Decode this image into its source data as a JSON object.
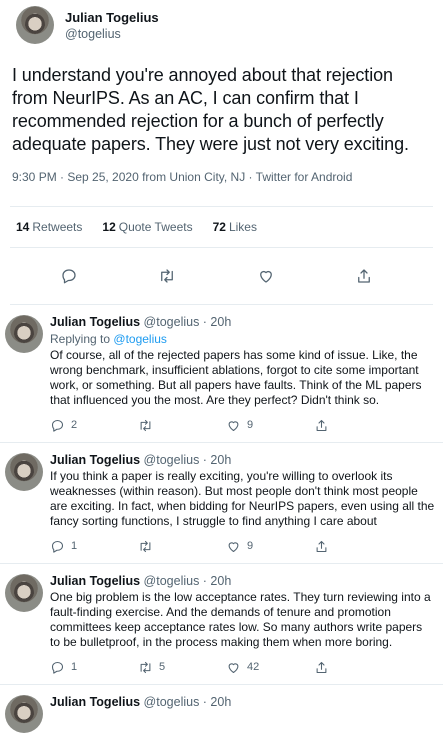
{
  "main_tweet": {
    "author_name": "Julian Togelius",
    "author_handle": "@togelius",
    "text": "I understand you're annoyed about that rejection from NeurIPS. As an AC, I can confirm that I recommended rejection for a bunch of perfectly adequate papers. They were just not very exciting.",
    "meta": "9:30 PM · Sep 25, 2020 from Union City, NJ · Twitter for Android",
    "stats": {
      "retweets_count": "14",
      "retweets_label": "Retweets",
      "quotes_count": "12",
      "quotes_label": "Quote Tweets",
      "likes_count": "72",
      "likes_label": "Likes"
    }
  },
  "replies": [
    {
      "name": "Julian Togelius",
      "handle_time": "@togelius · 20h",
      "replying_prefix": "Replying to",
      "replying_to": "@togelius",
      "text": "Of course, all of the rejected papers has some kind of issue. Like, the wrong benchmark, insufficient ablations, forgot to cite some important work, or something. But all papers have faults. Think of the ML papers that influenced you the most. Are they perfect? Didn't think so.",
      "reply_count": "2",
      "retweet_count": "",
      "like_count": "9"
    },
    {
      "name": "Julian Togelius",
      "handle_time": "@togelius · 20h",
      "text": "If you think a paper is really exciting, you're willing to overlook its weaknesses (within reason). But most people don't think most people are exciting. In fact, when bidding for NeurIPS papers, even using all the fancy sorting functions, I struggle to find anything I care about",
      "reply_count": "1",
      "retweet_count": "",
      "like_count": "9"
    },
    {
      "name": "Julian Togelius",
      "handle_time": "@togelius · 20h",
      "text": "One big problem is the low acceptance rates. They turn reviewing into a fault-finding exercise. And the demands of tenure and promotion committees keep acceptance rates low. So many authors write papers to be bulletproof, in the process making them when more boring.",
      "reply_count": "1",
      "retweet_count": "5",
      "like_count": "42"
    },
    {
      "name": "Julian Togelius",
      "handle_time": "@togelius · 20h"
    }
  ],
  "icons": [
    "reply-icon",
    "retweet-icon",
    "like-icon",
    "share-icon"
  ]
}
